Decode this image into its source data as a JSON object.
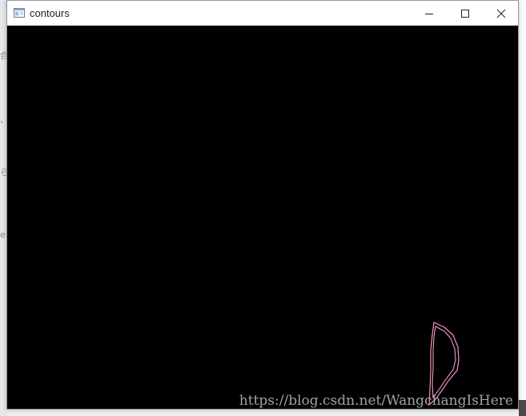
{
  "window": {
    "title": "contours"
  },
  "titlebar": {
    "icons": [
      "app-window-icon",
      "minimize-icon",
      "maximize-icon",
      "close-icon"
    ]
  },
  "canvas": {
    "background": "#000000",
    "contour_color": "#ff88cc",
    "watermark": "https://blog.csdn.net/WangchangIsHere"
  },
  "background_app": {
    "left_glyphs": [
      "合",
      "、",
      "ら",
      "e"
    ]
  }
}
